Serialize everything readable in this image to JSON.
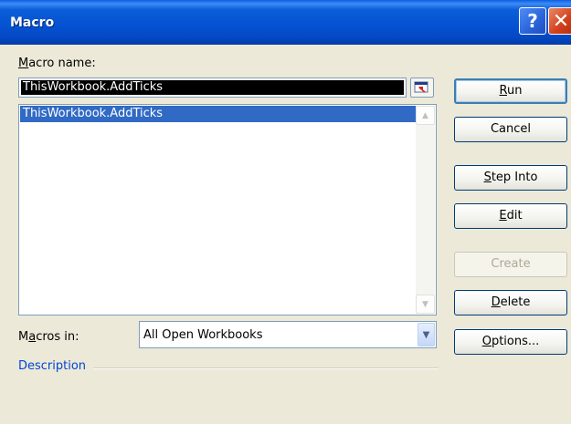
{
  "window": {
    "title": "Macro"
  },
  "title_buttons": {
    "help": "?",
    "close": "✕"
  },
  "macro_name": {
    "label": "Macro name:",
    "value": "ThisWorkbook.AddTicks"
  },
  "list": {
    "items": [
      "ThisWorkbook.AddTicks"
    ]
  },
  "macros_in": {
    "label": "Macros in:",
    "value": "All Open Workbooks"
  },
  "description": {
    "label": "Description"
  },
  "buttons": {
    "run": "Run",
    "cancel": "Cancel",
    "step_into": "Step Into",
    "edit": "Edit",
    "create": "Create",
    "delete": "Delete",
    "options": "Options..."
  },
  "icons": {
    "help": "help-icon",
    "close": "close-icon",
    "ref": "collapse-dialog-icon",
    "scroll_up": "chevron-up-icon",
    "scroll_down": "chevron-down-icon",
    "combo": "dropdown-arrow-icon"
  },
  "colors": {
    "title_bar": "#0451d2",
    "selection": "#316ac5",
    "close_button": "#d2401c",
    "description_text": "#0046d5"
  }
}
